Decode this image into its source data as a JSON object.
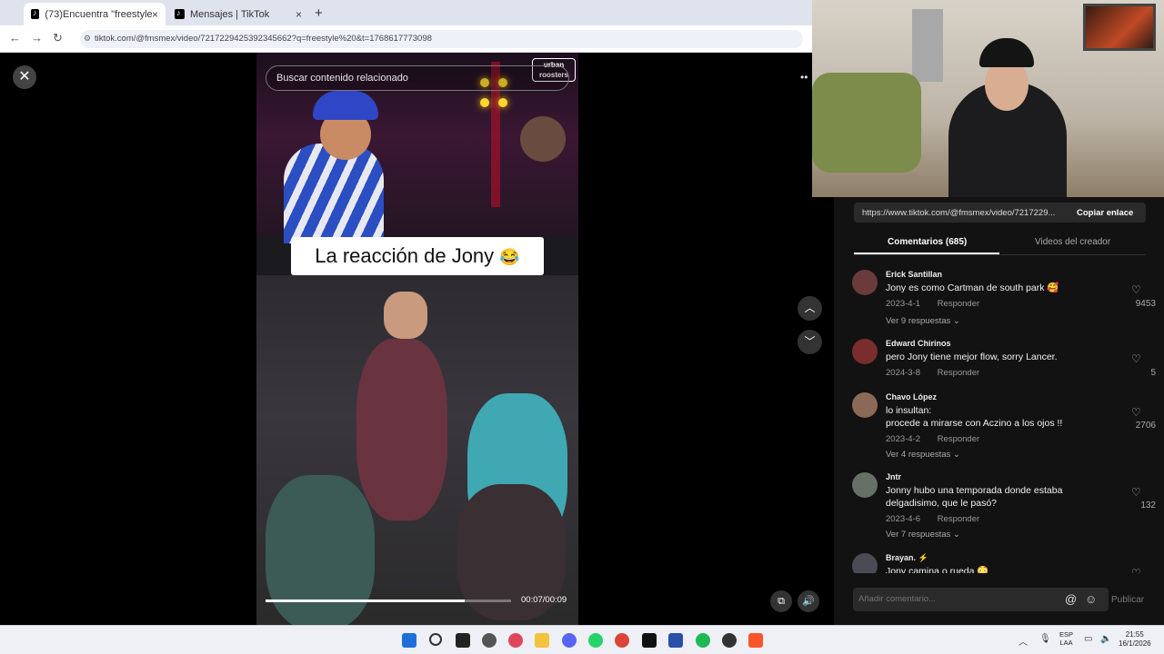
{
  "browser": {
    "tabs": [
      {
        "title": "(73)Encuentra \"freestyle\" en",
        "close": "×"
      },
      {
        "title": "Mensajes | TikTok",
        "close": "×"
      }
    ],
    "new_tab": "+",
    "url": "tiktok.com/@fmsmex/video/7217229425392345662?q=freestyle%20&t=1768617773098"
  },
  "video": {
    "close_icon": "✕",
    "search_placeholder": "Buscar contenido relacionado",
    "watermark": "urban roosters",
    "caption": "La reacción de Jony",
    "caption_emoji": "😂",
    "time": "00:07/00:09",
    "progress": 0.81
  },
  "panel": {
    "share_url": "https://www.tiktok.com/@fmsmex/video/7217229...",
    "copy_link": "Copiar enlace",
    "tabs": [
      {
        "label": "Comentarios (685)"
      },
      {
        "label": "Videos del creador"
      }
    ],
    "comments": [
      {
        "user": "Erick Santillan",
        "text": "Jony es como Cartman de south park 🥰",
        "date": "2023-4-1",
        "reply": "Responder",
        "more": "Ver 9 respuestas ⌄",
        "likes": "9453",
        "avatar_color": "#6b3b3b"
      },
      {
        "user": "Edward Chirinos",
        "text": "pero Jony tiene mejor flow, sorry Lancer.",
        "date": "2024-3-8",
        "reply": "Responder",
        "more": "",
        "likes": "5",
        "avatar_color": "#7a2d2d"
      },
      {
        "user": "Chavo López",
        "text": "lo insultan:\nprocede a mirarse con Aczino a los ojos !!",
        "date": "2023-4-2",
        "reply": "Responder",
        "more": "Ver 4 respuestas ⌄",
        "likes": "2706",
        "avatar_color": "#8a6a56"
      },
      {
        "user": "Jntr",
        "text": "Jonny hubo una temporada donde estaba delgadisimo, que le pasó?",
        "date": "2023-4-6",
        "reply": "Responder",
        "more": "Ver 7 respuestas ⌄",
        "likes": "132",
        "avatar_color": "#667066"
      },
      {
        "user": "Brayan. ⚡",
        "text": "Jony camina o rueda 😳",
        "date": "",
        "reply": "",
        "more": "",
        "likes": "",
        "avatar_color": "#4b4b55"
      }
    ],
    "add_comment_placeholder": "Añadir comentario...",
    "publish": "Publicar"
  },
  "taskbar": {
    "lang": "ESP\nLAA",
    "time": "21:55",
    "date": "16/1/2026"
  }
}
